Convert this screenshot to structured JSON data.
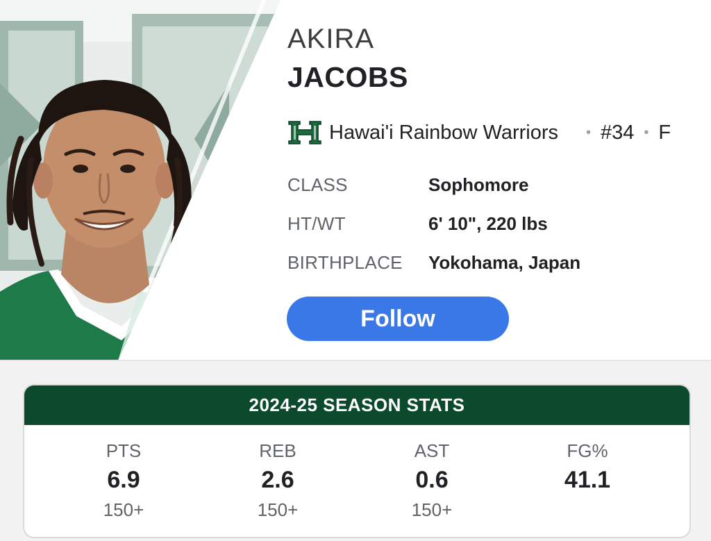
{
  "player": {
    "first_name": "AKIRA",
    "last_name": "JACOBS",
    "team": "Hawai'i Rainbow Warriors",
    "number": "#34",
    "position": "F",
    "team_logo_icon": "hawaii-h-logo-icon",
    "photo_alt": "player-headshot"
  },
  "separator": "•",
  "info": [
    {
      "label": "CLASS",
      "value": "Sophomore"
    },
    {
      "label": "HT/WT",
      "value": "6' 10\", 220 lbs"
    },
    {
      "label": "BIRTHPLACE",
      "value": "Yokohama, Japan"
    }
  ],
  "follow_label": "Follow",
  "stats": {
    "title": "2024-25 SEASON STATS",
    "items": [
      {
        "label": "PTS",
        "value": "6.9",
        "rank": "150+"
      },
      {
        "label": "REB",
        "value": "2.6",
        "rank": "150+"
      },
      {
        "label": "AST",
        "value": "0.6",
        "rank": "150+"
      },
      {
        "label": "FG%",
        "value": "41.1",
        "rank": ""
      }
    ]
  },
  "colors": {
    "team_green": "#0b4a2c",
    "accent_blue": "#3b78e7",
    "logo_green": "#1b6b3f"
  }
}
